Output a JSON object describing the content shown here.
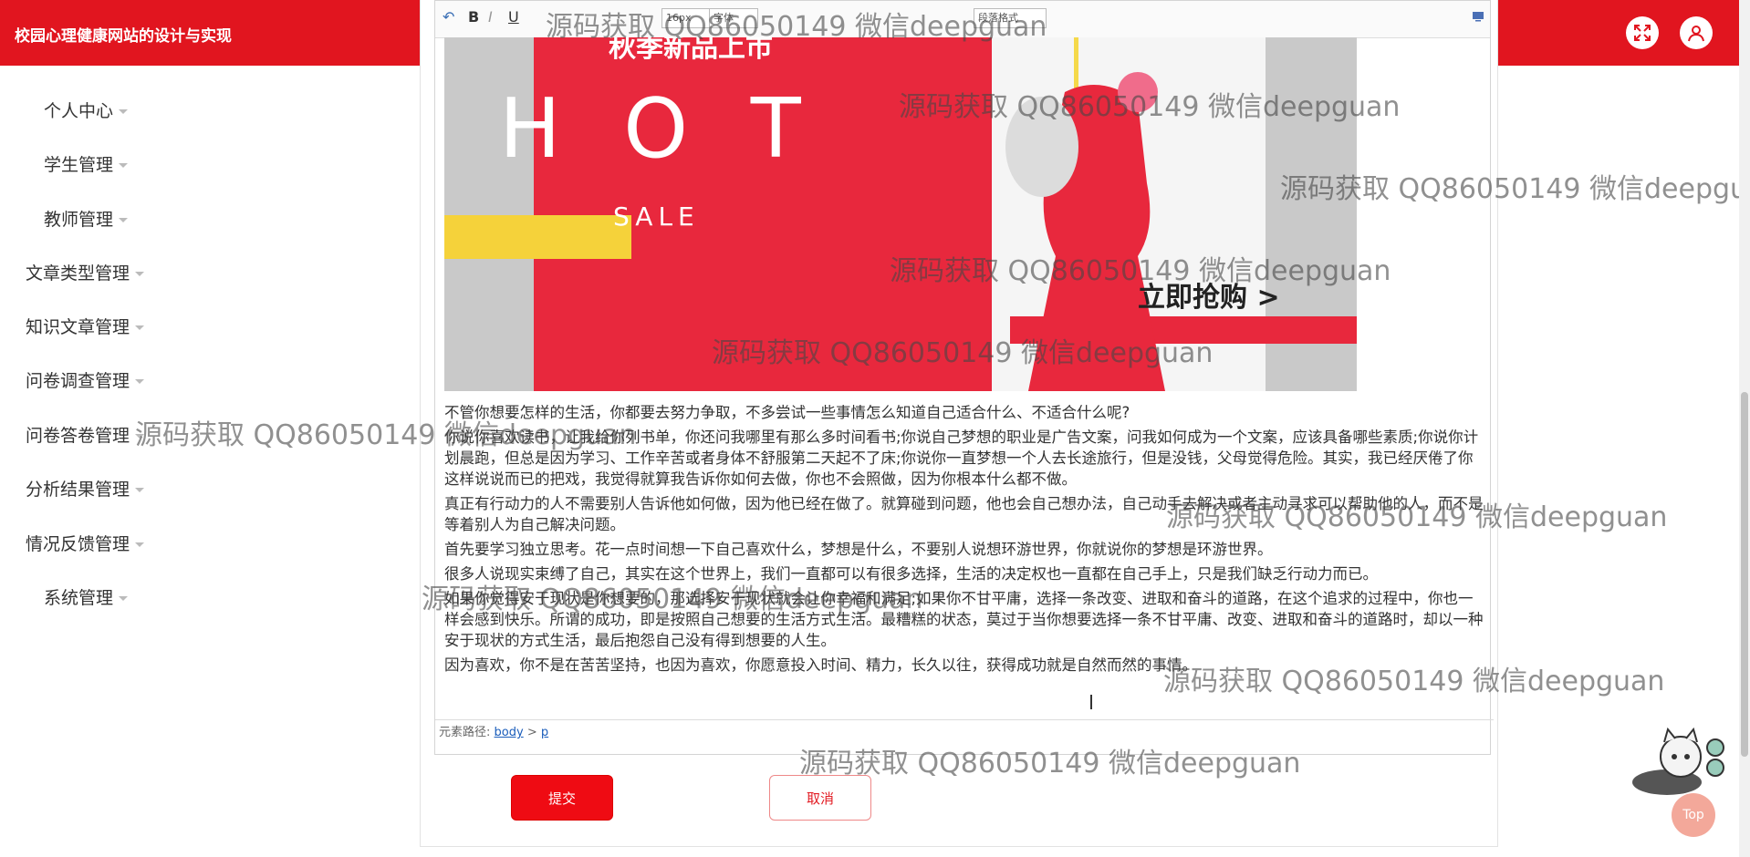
{
  "header": {
    "site_title": "校园心理健康网站的设计与实现"
  },
  "sidebar": {
    "items": [
      {
        "label": "个人中心"
      },
      {
        "label": "学生管理"
      },
      {
        "label": "教师管理"
      },
      {
        "label": "文章类型管理"
      },
      {
        "label": "知识文章管理"
      },
      {
        "label": "问卷调查管理"
      },
      {
        "label": "问卷答卷管理"
      },
      {
        "label": "分析结果管理"
      },
      {
        "label": "情况反馈管理"
      },
      {
        "label": "系统管理"
      }
    ]
  },
  "editor": {
    "toolbar": {
      "bold": "B",
      "italic": "I",
      "underline": "U",
      "font_size": "16px",
      "font_style": "字体",
      "paragraph": "段落格式"
    },
    "banner": {
      "top_text": "秋季新品上市",
      "hot_text": "H O T",
      "sale_text": "SALE",
      "cta_text": "立即抢购 >"
    },
    "paragraphs": [
      "不管你想要怎样的生活，你都要去努力争取，不多尝试一些事情怎么知道自己适合什么、不适合什么呢?",
      "你说你喜欢读书，让我给你列书单，你还问我哪里有那么多时间看书;你说自己梦想的职业是广告文案，问我如何成为一个文案，应该具备哪些素质;你说你计划晨跑，但总是因为学习、工作辛苦或者身体不舒服第二天起不了床;你说你一直梦想一个人去长途旅行，但是没钱，父母觉得危险。其实，我已经厌倦了你这样说说而已的把戏，我觉得就算我告诉你如何去做，你也不会照做，因为你根本什么都不做。",
      "真正有行动力的人不需要别人告诉他如何做，因为他已经在做了。就算碰到问题，他也会自己想办法，自己动手去解决或者主动寻求可以帮助他的人，而不是等着别人为自己解决问题。",
      "首先要学习独立思考。花一点时间想一下自己喜欢什么，梦想是什么，不要别人说想环游世界，你就说你的梦想是环游世界。",
      "很多人说现实束缚了自己，其实在这个世界上，我们一直都可以有很多选择，生活的决定权也一直都在自己手上，只是我们缺乏行动力而已。",
      "如果你觉得安于现状是你想要的，那选择安于现状就会让你幸福和满足;如果你不甘平庸，选择一条改变、进取和奋斗的道路，在这个追求的过程中，你也一样会感到快乐。所谓的成功，即是按照自己想要的生活方式生活。最糟糕的状态，莫过于当你想要选择一条不甘平庸、改变、进取和奋斗的道路时，却以一种安于现状的方式生活，最后抱怨自己没有得到想要的人生。",
      "因为喜欢，你不是在苦苦坚持，也因为喜欢，你愿意投入时间、精力，长久以往，获得成功就是自然而然的事情。"
    ],
    "path": {
      "label": "元素路径:",
      "body": "body",
      "sep": ">",
      "p": "p"
    }
  },
  "actions": {
    "submit_label": "提交",
    "cancel_label": "取消"
  },
  "watermark": {
    "text": "源码获取 QQ86050149 微信deepguan"
  },
  "top_button": {
    "label": "Top"
  },
  "colors": {
    "brand_red": "#e1151f",
    "submit_red": "#ef0b13"
  }
}
